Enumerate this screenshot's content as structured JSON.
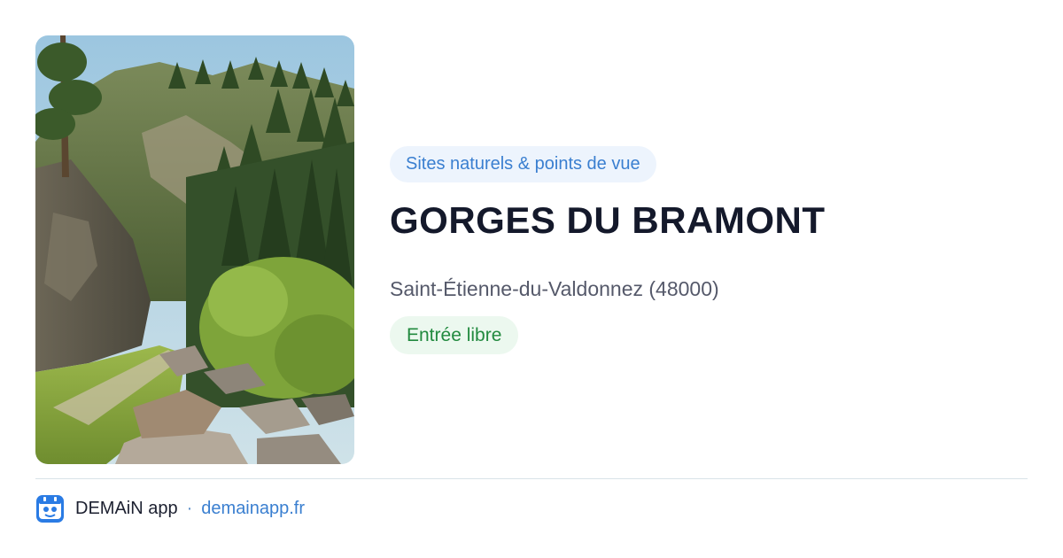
{
  "card": {
    "category": "Sites naturels & points de vue",
    "title": "GORGES DU BRAMONT",
    "location": "Saint-Étienne-du-Valdonnez (48000)",
    "entry": "Entrée libre",
    "photo_icon": "gorge-landscape-photo"
  },
  "footer": {
    "app_name": "DEMAiN app",
    "separator": "·",
    "domain": "demainapp.fr",
    "logo_icon": "demain-app-logo-icon"
  },
  "colors": {
    "category_text": "#3a7fd0",
    "category_bg": "#edf4fd",
    "entry_text": "#228a3f",
    "entry_bg": "#ecf8ef",
    "title_text": "#14192b",
    "link": "#3a7fd0"
  }
}
